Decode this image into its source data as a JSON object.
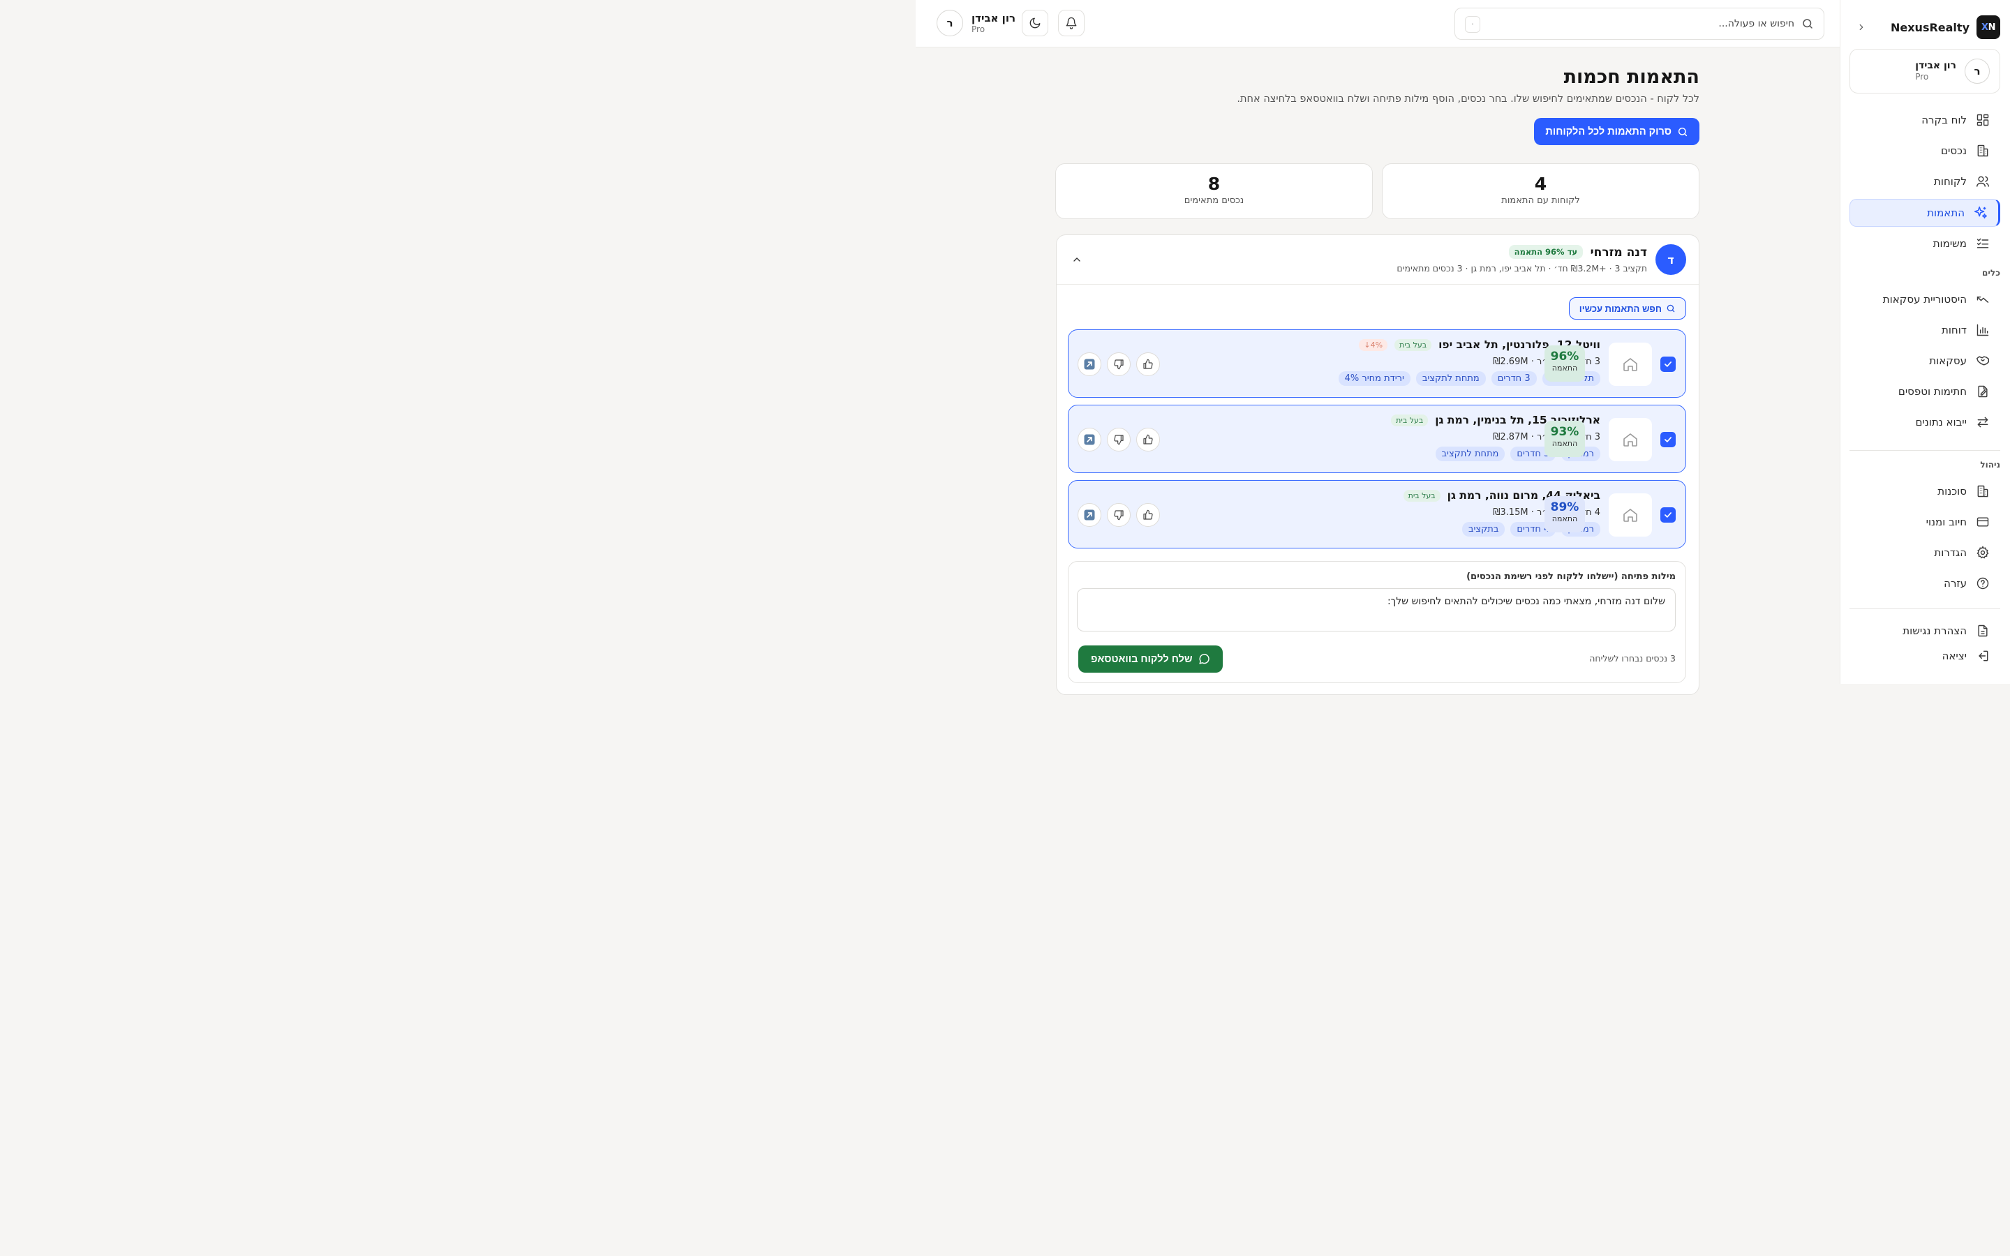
{
  "app": {
    "name": "NexusRealty",
    "logo_text": "N",
    "logo_x": "X"
  },
  "user": {
    "initial": "ר",
    "name": "רון אבידן",
    "plan": "Pro"
  },
  "search": {
    "placeholder": "חיפוש או פעולה...",
    "shortcut": "·"
  },
  "sidebar": {
    "main_items": [
      {
        "label": "לוח בקרה",
        "icon": "dashboard-icon"
      },
      {
        "label": "נכסים",
        "icon": "building-icon"
      },
      {
        "label": "לקוחות",
        "icon": "users-icon"
      },
      {
        "label": "התאמות",
        "icon": "sparkles-icon",
        "active": true
      },
      {
        "label": "משימות",
        "icon": "tasks-icon"
      }
    ],
    "tools_title": "כלים",
    "tools_items": [
      {
        "label": "היסטוריית עסקאות",
        "icon": "trend-icon"
      },
      {
        "label": "דוחות",
        "icon": "chart-icon"
      },
      {
        "label": "עסקאות",
        "icon": "handshake-icon"
      },
      {
        "label": "חתימות וטפסים",
        "icon": "signature-icon"
      },
      {
        "label": "ייבוא נתונים",
        "icon": "import-icon"
      }
    ],
    "admin_title": "ניהול",
    "admin_items": [
      {
        "label": "סוכנות",
        "icon": "building-icon"
      },
      {
        "label": "חיוב ומנוי",
        "icon": "credit-card-icon"
      },
      {
        "label": "הגדרות",
        "icon": "gear-icon"
      },
      {
        "label": "עזרה",
        "icon": "help-icon"
      }
    ],
    "footer_items": [
      {
        "label": "הצהרת נגישות",
        "icon": "document-icon"
      },
      {
        "label": "יציאה",
        "icon": "logout-icon"
      }
    ]
  },
  "page": {
    "title": "התאמות חכמות",
    "subtitle": "לכל לקוח - הנכסים שמתאימים לחיפוש שלו. בחר נכסים, הוסף מילות פתיחה ושלח בוואטסאפ בלחיצה אחת.",
    "scan_button": "סרוק התאמות לכל הלקוחות"
  },
  "stats": [
    {
      "value": "4",
      "label": "לקוחות עם התאמות"
    },
    {
      "value": "8",
      "label": "נכסים מתאימים"
    }
  ],
  "client": {
    "initial": "ד",
    "name": "דנה מזרחי",
    "badge": "עד 96% התאמה",
    "meta": "תקציב ₪3.2M+ · 3 חד׳ · תל אביב יפו, רמת גן · 3 נכסים מתאימים",
    "find_button": "חפש התאמות עכשיו"
  },
  "properties": [
    {
      "address": "וויטל 12, פלורנטין, תל אביב יפו",
      "owner_chip": "בעל בית",
      "drop_chip": "4%↓",
      "specs": "3 חד׳ · 74 מ״ר · ₪2.69M",
      "tags": [
        "תל אביב יפו",
        "3 חדרים",
        "מתחת לתקציב",
        "ירידת מחיר 4%"
      ],
      "score": "96%",
      "score_label": "התאמה",
      "score_color": "green"
    },
    {
      "address": "ארלוזורוב 15, תל בנימין, רמת גן",
      "owner_chip": "בעל בית",
      "specs": "3 חד׳ · 80 מ״ר · ₪2.87M",
      "tags": [
        "רמת גן",
        "3 חדרים",
        "מתחת לתקציב"
      ],
      "score": "93%",
      "score_label": "התאמה",
      "score_color": "green"
    },
    {
      "address": "ביאליק 44, מרום נווה, רמת גן",
      "owner_chip": "בעל בית",
      "specs": "4 חד׳ · 98 מ״ר · ₪3.15M",
      "tags": [
        "רמת גן",
        "4 חדרים",
        "בתקציב"
      ],
      "score": "89%",
      "score_label": "התאמה",
      "score_color": "blue"
    }
  ],
  "opening": {
    "label": "מילות פתיחה (יישלחו ללקוח לפני רשימת הנכסים)",
    "text": "שלום דנה מזרחי, מצאתי כמה נכסים שיכולים להתאים לחיפוש שלך:",
    "selected_count": "3 נכסים נבחרו לשליחה",
    "send_button": "שלח ללקוח בוואטסאפ"
  },
  "colors": {
    "accent": "#2b5cff",
    "whatsapp": "#1f7a3f",
    "match_green": "#1f7a3f"
  }
}
